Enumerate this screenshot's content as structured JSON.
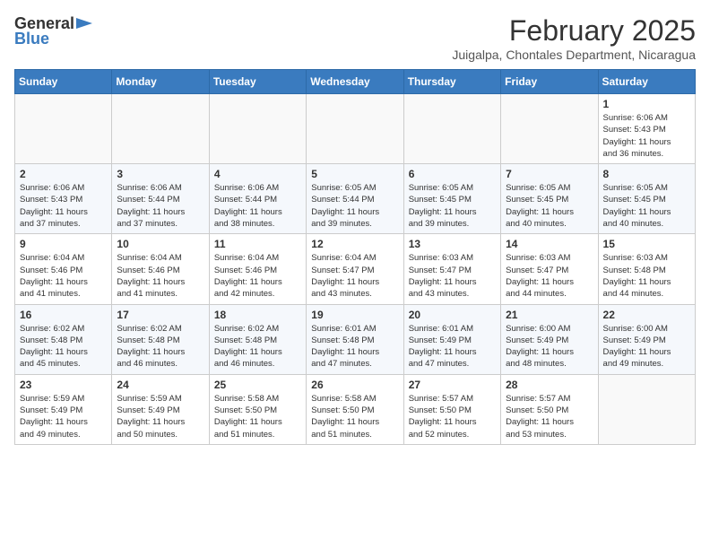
{
  "header": {
    "logo": {
      "general": "General",
      "blue": "Blue"
    },
    "title": "February 2025",
    "location": "Juigalpa, Chontales Department, Nicaragua"
  },
  "calendar": {
    "weekdays": [
      "Sunday",
      "Monday",
      "Tuesday",
      "Wednesday",
      "Thursday",
      "Friday",
      "Saturday"
    ],
    "weeks": [
      [
        {
          "day": "",
          "info": ""
        },
        {
          "day": "",
          "info": ""
        },
        {
          "day": "",
          "info": ""
        },
        {
          "day": "",
          "info": ""
        },
        {
          "day": "",
          "info": ""
        },
        {
          "day": "",
          "info": ""
        },
        {
          "day": "1",
          "info": "Sunrise: 6:06 AM\nSunset: 5:43 PM\nDaylight: 11 hours\nand 36 minutes."
        }
      ],
      [
        {
          "day": "2",
          "info": "Sunrise: 6:06 AM\nSunset: 5:43 PM\nDaylight: 11 hours\nand 37 minutes."
        },
        {
          "day": "3",
          "info": "Sunrise: 6:06 AM\nSunset: 5:44 PM\nDaylight: 11 hours\nand 37 minutes."
        },
        {
          "day": "4",
          "info": "Sunrise: 6:06 AM\nSunset: 5:44 PM\nDaylight: 11 hours\nand 38 minutes."
        },
        {
          "day": "5",
          "info": "Sunrise: 6:05 AM\nSunset: 5:44 PM\nDaylight: 11 hours\nand 39 minutes."
        },
        {
          "day": "6",
          "info": "Sunrise: 6:05 AM\nSunset: 5:45 PM\nDaylight: 11 hours\nand 39 minutes."
        },
        {
          "day": "7",
          "info": "Sunrise: 6:05 AM\nSunset: 5:45 PM\nDaylight: 11 hours\nand 40 minutes."
        },
        {
          "day": "8",
          "info": "Sunrise: 6:05 AM\nSunset: 5:45 PM\nDaylight: 11 hours\nand 40 minutes."
        }
      ],
      [
        {
          "day": "9",
          "info": "Sunrise: 6:04 AM\nSunset: 5:46 PM\nDaylight: 11 hours\nand 41 minutes."
        },
        {
          "day": "10",
          "info": "Sunrise: 6:04 AM\nSunset: 5:46 PM\nDaylight: 11 hours\nand 41 minutes."
        },
        {
          "day": "11",
          "info": "Sunrise: 6:04 AM\nSunset: 5:46 PM\nDaylight: 11 hours\nand 42 minutes."
        },
        {
          "day": "12",
          "info": "Sunrise: 6:04 AM\nSunset: 5:47 PM\nDaylight: 11 hours\nand 43 minutes."
        },
        {
          "day": "13",
          "info": "Sunrise: 6:03 AM\nSunset: 5:47 PM\nDaylight: 11 hours\nand 43 minutes."
        },
        {
          "day": "14",
          "info": "Sunrise: 6:03 AM\nSunset: 5:47 PM\nDaylight: 11 hours\nand 44 minutes."
        },
        {
          "day": "15",
          "info": "Sunrise: 6:03 AM\nSunset: 5:48 PM\nDaylight: 11 hours\nand 44 minutes."
        }
      ],
      [
        {
          "day": "16",
          "info": "Sunrise: 6:02 AM\nSunset: 5:48 PM\nDaylight: 11 hours\nand 45 minutes."
        },
        {
          "day": "17",
          "info": "Sunrise: 6:02 AM\nSunset: 5:48 PM\nDaylight: 11 hours\nand 46 minutes."
        },
        {
          "day": "18",
          "info": "Sunrise: 6:02 AM\nSunset: 5:48 PM\nDaylight: 11 hours\nand 46 minutes."
        },
        {
          "day": "19",
          "info": "Sunrise: 6:01 AM\nSunset: 5:48 PM\nDaylight: 11 hours\nand 47 minutes."
        },
        {
          "day": "20",
          "info": "Sunrise: 6:01 AM\nSunset: 5:49 PM\nDaylight: 11 hours\nand 47 minutes."
        },
        {
          "day": "21",
          "info": "Sunrise: 6:00 AM\nSunset: 5:49 PM\nDaylight: 11 hours\nand 48 minutes."
        },
        {
          "day": "22",
          "info": "Sunrise: 6:00 AM\nSunset: 5:49 PM\nDaylight: 11 hours\nand 49 minutes."
        }
      ],
      [
        {
          "day": "23",
          "info": "Sunrise: 5:59 AM\nSunset: 5:49 PM\nDaylight: 11 hours\nand 49 minutes."
        },
        {
          "day": "24",
          "info": "Sunrise: 5:59 AM\nSunset: 5:49 PM\nDaylight: 11 hours\nand 50 minutes."
        },
        {
          "day": "25",
          "info": "Sunrise: 5:58 AM\nSunset: 5:50 PM\nDaylight: 11 hours\nand 51 minutes."
        },
        {
          "day": "26",
          "info": "Sunrise: 5:58 AM\nSunset: 5:50 PM\nDaylight: 11 hours\nand 51 minutes."
        },
        {
          "day": "27",
          "info": "Sunrise: 5:57 AM\nSunset: 5:50 PM\nDaylight: 11 hours\nand 52 minutes."
        },
        {
          "day": "28",
          "info": "Sunrise: 5:57 AM\nSunset: 5:50 PM\nDaylight: 11 hours\nand 53 minutes."
        },
        {
          "day": "",
          "info": ""
        }
      ]
    ]
  }
}
